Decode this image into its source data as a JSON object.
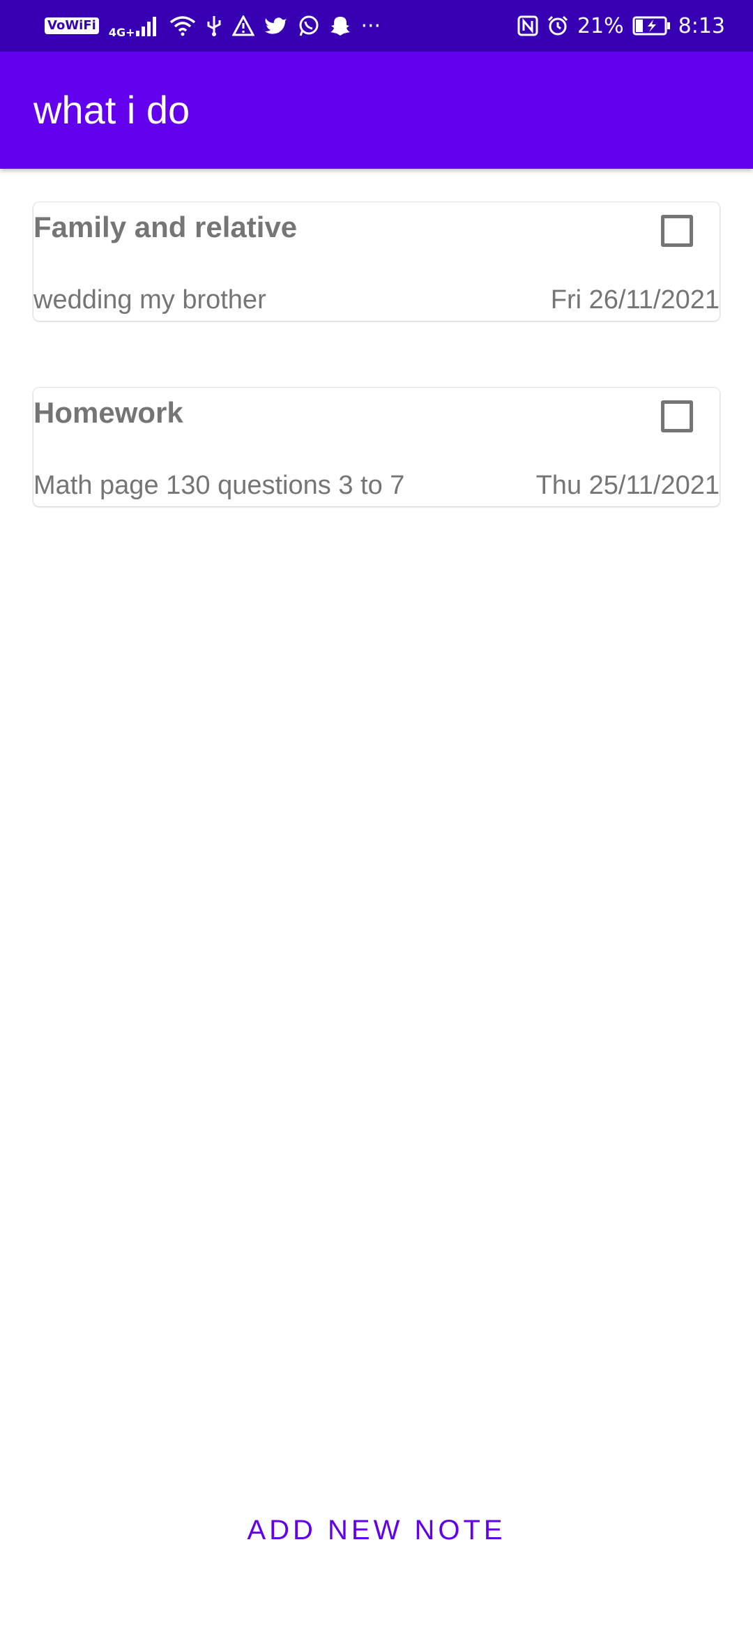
{
  "status_bar": {
    "vowifi": "VoWiFi",
    "network": "4G+",
    "more": "···",
    "battery": "21%",
    "time": "8:13"
  },
  "app_bar": {
    "title": "what i do"
  },
  "notes": [
    {
      "title": "Family and relative",
      "description": "wedding my brother",
      "date": "Fri 26/11/2021",
      "checked": false
    },
    {
      "title": "Homework",
      "description": "Math page 130 questions 3 to 7",
      "date": "Thu 25/11/2021",
      "checked": false
    }
  ],
  "add_button": {
    "label": "ADD NEW NOTE"
  },
  "colors": {
    "status_bar": "#3700B3",
    "app_bar": "#6200EE",
    "accent": "#6200EE",
    "text_gray": "#757575"
  }
}
